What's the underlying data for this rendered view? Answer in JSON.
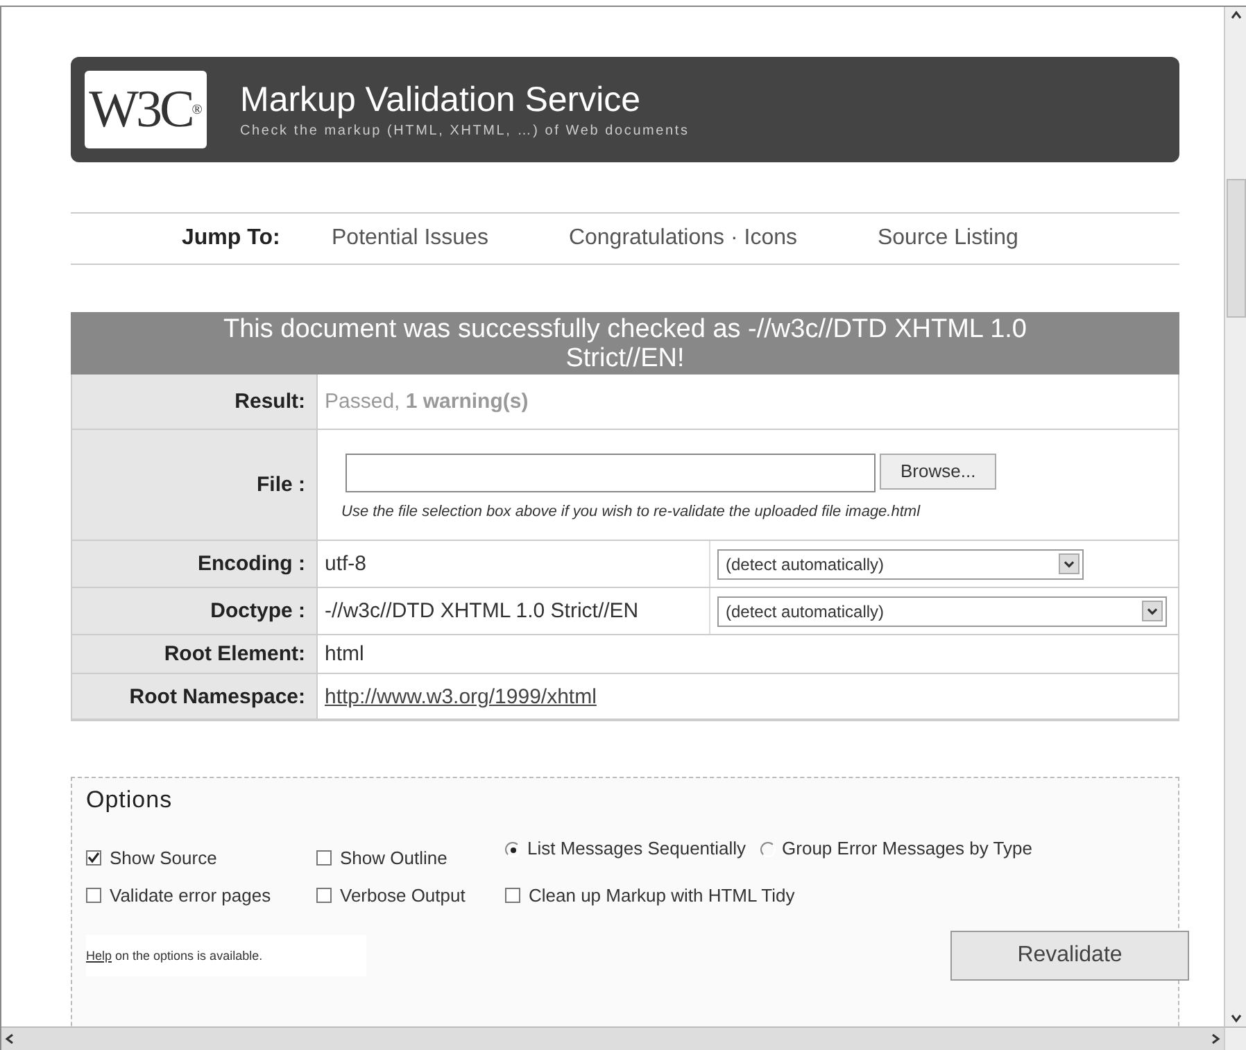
{
  "header": {
    "logo": "W3C",
    "logo_mark": "®",
    "title": "Markup Validation Service",
    "subtitle": "Check the markup (HTML, XHTML, …) of Web documents"
  },
  "jump_nav": {
    "label": "Jump To:",
    "links": [
      "Potential Issues",
      "Congratulations · Icons",
      "Source Listing"
    ]
  },
  "result_banner": "This document was successfully checked as -//w3c//DTD XHTML 1.0 Strict//EN!",
  "rows": [
    {
      "kind": "text",
      "label": "Result:",
      "value": "Passed, **1 warning(s)**"
    },
    {
      "kind": "file",
      "label": "File :",
      "button": "Browse...",
      "note": "Use the file selection box above if you wish to re-validate the uploaded file image.html"
    },
    {
      "kind": "select",
      "label": "Encoding :",
      "value": "utf-8",
      "select": "(detect automatically)",
      "wide": false
    },
    {
      "kind": "select",
      "label": "Doctype :",
      "value": "-//w3c//DTD XHTML 1.0 Strict//EN",
      "select": "(detect automatically)",
      "wide": true
    },
    {
      "kind": "plain",
      "label": "Root Element:",
      "value": "html"
    },
    {
      "kind": "link",
      "label": "Root Namespace:",
      "value": "http://www.w3.org/1999/xhtml"
    }
  ],
  "options": {
    "title": "Options",
    "rows": [
      [
        {
          "kind": "checkbox",
          "label": "Show Source",
          "checked": true
        },
        {
          "kind": "checkbox",
          "label": "Show Outline",
          "checked": false
        },
        {
          "kind": "radio",
          "label": "List Messages Sequentially",
          "selected": true
        },
        {
          "kind": "radio",
          "label": "Group Error Messages by Type",
          "selected": false
        }
      ],
      [
        {
          "kind": "checkbox",
          "label": "Validate error pages",
          "checked": false
        },
        {
          "kind": "checkbox",
          "label": "Verbose Output",
          "checked": false
        },
        {
          "kind": "checkbox",
          "label": "Clean up Markup with HTML Tidy",
          "checked": false
        }
      ]
    ],
    "help_link": "Help",
    "help_text": " on the options is available.",
    "button": "Revalidate"
  }
}
